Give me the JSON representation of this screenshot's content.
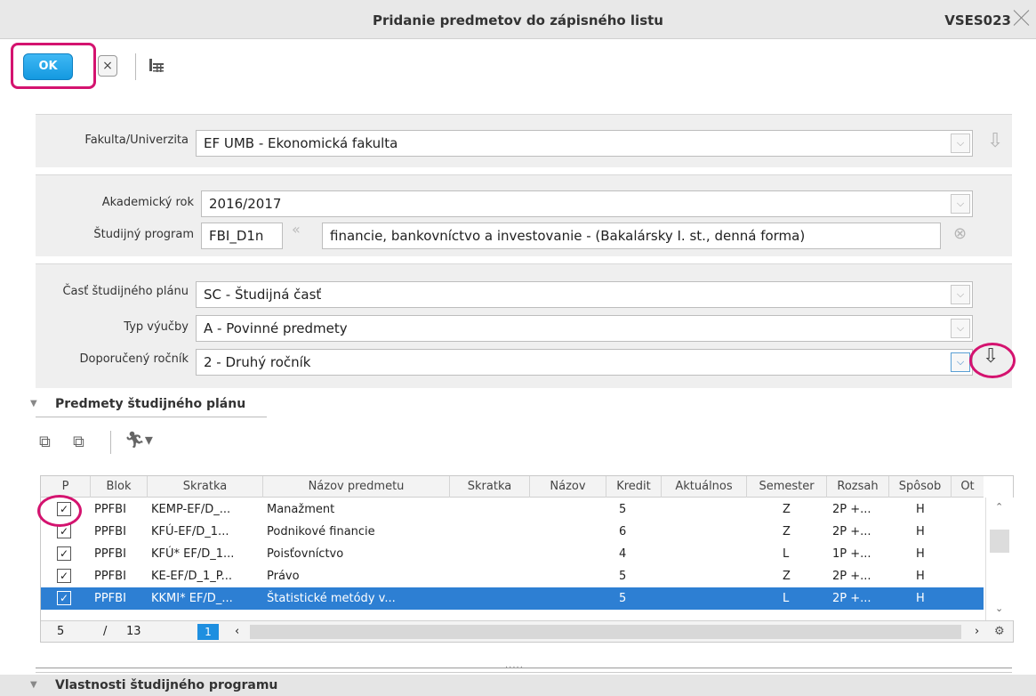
{
  "window": {
    "title": "Pridanie predmetov do zápisného listu",
    "code": "VSES023"
  },
  "toolbar": {
    "ok_label": "OK",
    "cancel_glyph": "×",
    "grid_icon": "table-settings-icon"
  },
  "filters": {
    "faculty": {
      "label": "Fakulta/Univerzita",
      "value": "EF UMB - Ekonomická fakulta"
    },
    "year": {
      "label": "Akademický rok",
      "value": "2016/2017"
    },
    "program": {
      "label": "Študijný program",
      "code": "FBI_D1n",
      "value": "financie, bankovníctvo a investovanie - (Bakalársky I. st., denná forma)"
    },
    "plan_part": {
      "label": "Časť študijného plánu",
      "value": "SC - Študijná časť"
    },
    "teaching_type": {
      "label": "Typ výučby",
      "value": "A - Povinné predmety"
    },
    "recommended_year": {
      "label": "Doporučený ročník",
      "value": "2 - Druhý ročník"
    }
  },
  "subjects_section": {
    "title": "Predmety študijného plánu",
    "columns": [
      "P",
      "Blok",
      "Skratka",
      "Názov predmetu",
      "Skratka",
      "Názov",
      "Kredit",
      "Aktuálnos",
      "Semester",
      "Rozsah",
      "Spôsob",
      "Ot"
    ],
    "rows": [
      {
        "checked": true,
        "blok": "PPFBI",
        "skratka": "KEMP-EF/D_...",
        "nazov": "Manažment",
        "kredit": "5",
        "semester": "Z",
        "rozsah": "2P +...",
        "sposob": "H"
      },
      {
        "checked": true,
        "blok": "PPFBI",
        "skratka": "KFÚ-EF/D_1...",
        "nazov": "Podnikové financie",
        "kredit": "6",
        "semester": "Z",
        "rozsah": "2P +...",
        "sposob": "H"
      },
      {
        "checked": true,
        "blok": "PPFBI",
        "skratka": "KFÚ* EF/D_1...",
        "nazov": "Poisťovníctvo",
        "kredit": "4",
        "semester": "L",
        "rozsah": "1P +...",
        "sposob": "H"
      },
      {
        "checked": true,
        "blok": "PPFBI",
        "skratka": "KE-EF/D_1_P...",
        "nazov": "Právo",
        "kredit": "5",
        "semester": "Z",
        "rozsah": "2P +...",
        "sposob": "H"
      },
      {
        "checked": true,
        "blok": "PPFBI",
        "skratka": "KKMI* EF/D_...",
        "nazov": "Štatistické metódy v...",
        "kredit": "5",
        "semester": "L",
        "rozsah": "2P +...",
        "sposob": "H",
        "selected": true
      }
    ],
    "pager": {
      "current_row": "5",
      "separator": "/",
      "total": "13",
      "page": "1"
    }
  },
  "bottom_section": {
    "title": "Vlastnosti študijného programu"
  },
  "colors": {
    "accent": "#1e8fe0",
    "highlight": "#d4136f",
    "selection": "#2d7fd3"
  }
}
